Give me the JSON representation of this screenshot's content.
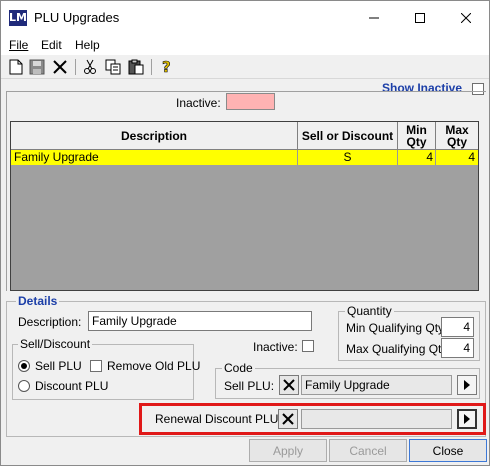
{
  "window": {
    "title": "PLU Upgrades",
    "app_icon_text": "LM"
  },
  "menu": [
    {
      "label": "File",
      "mnemonic": "F"
    },
    {
      "label": "Edit",
      "mnemonic": "E"
    },
    {
      "label": "Help",
      "mnemonic": "H"
    }
  ],
  "toolbar": [
    "new-icon",
    "save-icon",
    "delete-icon",
    "cut-icon",
    "copy-icon",
    "paste-icon",
    "help-icon"
  ],
  "show_inactive": {
    "label": "Show Inactive",
    "checked": false
  },
  "inactive_legend": {
    "label": "Inactive:",
    "color": "#ffb3b3"
  },
  "grid": {
    "headers": {
      "description": "Description",
      "sell_or_discount": "Sell or Discount",
      "min_qty": "Min Qty",
      "max_qty": "Max Qty"
    },
    "rows": [
      {
        "description": "Family Upgrade",
        "sell_or_discount": "S",
        "min_qty": "4",
        "max_qty": "4",
        "highlight": "#ffff00"
      }
    ]
  },
  "details": {
    "legend": "Details",
    "description_label": "Description:",
    "description_value": "Family Upgrade",
    "inactive_label": "Inactive:",
    "inactive_checked": false,
    "sell_discount": {
      "legend": "Sell/Discount",
      "sell_plu": "Sell PLU",
      "discount_plu": "Discount PLU",
      "remove_old_plu": "Remove Old PLU",
      "selected": "sell_plu"
    },
    "quantity": {
      "legend": "Quantity",
      "min_label": "Min Qualifying Qty:",
      "min_value": "4",
      "max_label": "Max Qualifying Qty:",
      "max_value": "4"
    },
    "code": {
      "legend": "Code",
      "sell_plu_label": "Sell PLU:",
      "sell_plu_value": "Family Upgrade"
    },
    "renewal": {
      "label": "Renewal Discount PLU:",
      "value": ""
    }
  },
  "buttons": {
    "apply": "Apply",
    "cancel": "Cancel",
    "close": "Close"
  }
}
